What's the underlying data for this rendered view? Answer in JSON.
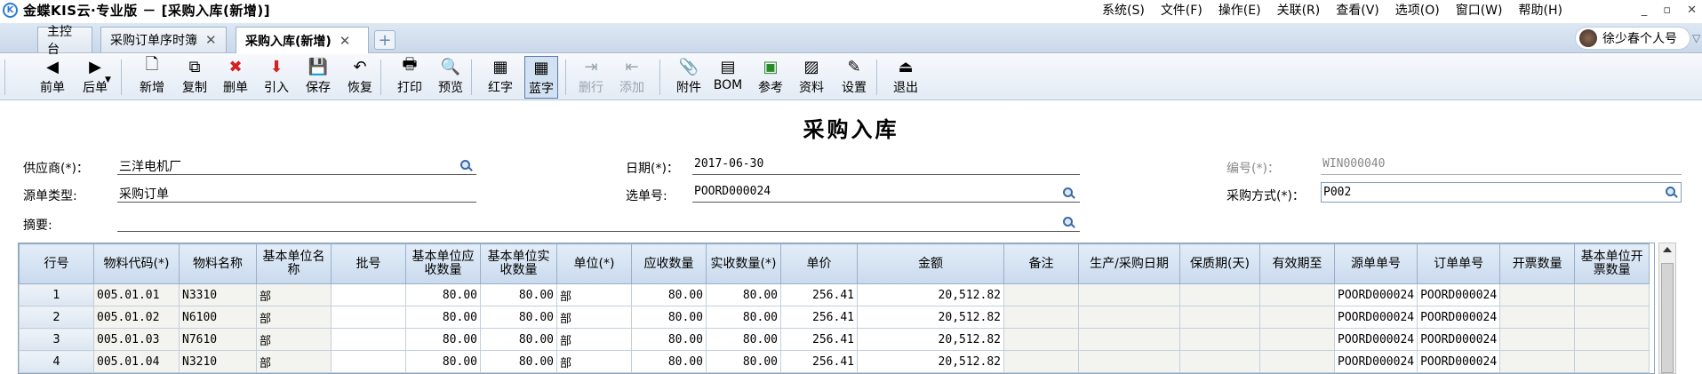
{
  "app": {
    "title": "金蝶KIS云·专业版 － [采购入库(新增)]",
    "menu": [
      "系统(S)",
      "文件(F)",
      "操作(E)",
      "关联(R)",
      "查看(V)",
      "选项(O)",
      "窗口(W)",
      "帮助(H)"
    ],
    "window_controls": [
      "_",
      "▫",
      "✕"
    ]
  },
  "tabs": [
    {
      "label": "主控台",
      "closable": false,
      "active": false
    },
    {
      "label": "采购订单序时簿",
      "closable": true,
      "active": false
    },
    {
      "label": "采购入库(新增)",
      "closable": true,
      "active": true
    }
  ],
  "tab_add_icon": "+",
  "user": {
    "name": "徐少春个人号"
  },
  "toolbar": [
    {
      "id": "prev",
      "label": "前单",
      "icon": "◀",
      "icon_name": "prev-arrow-icon"
    },
    {
      "id": "next",
      "label": "后单",
      "icon": "▶",
      "icon_name": "next-arrow-icon"
    },
    {
      "id": "new",
      "label": "新增",
      "icon": "🗋",
      "icon_name": "new-doc-icon"
    },
    {
      "id": "copy",
      "label": "复制",
      "icon": "⧉",
      "icon_name": "copy-icon"
    },
    {
      "id": "delete",
      "label": "删单",
      "icon": "✖",
      "icon_name": "delete-icon",
      "color": "#d32020"
    },
    {
      "id": "import",
      "label": "引入",
      "icon": "⬇",
      "icon_name": "import-icon",
      "color": "#d32020"
    },
    {
      "id": "save",
      "label": "保存",
      "icon": "💾",
      "icon_name": "save-icon"
    },
    {
      "id": "restore",
      "label": "恢复",
      "icon": "↶",
      "icon_name": "restore-icon"
    },
    {
      "id": "print",
      "label": "打印",
      "icon": "🖶",
      "icon_name": "print-icon"
    },
    {
      "id": "preview",
      "label": "预览",
      "icon": "🔍",
      "icon_name": "preview-icon"
    },
    {
      "id": "red",
      "label": "红字",
      "icon": "▦",
      "icon_name": "red-invoice-icon"
    },
    {
      "id": "blue",
      "label": "蓝字",
      "icon": "▦",
      "icon_name": "blue-invoice-icon",
      "pressed": true
    },
    {
      "id": "delrow",
      "label": "删行",
      "icon": "⇥",
      "icon_name": "delete-row-icon",
      "disabled": true
    },
    {
      "id": "addrow",
      "label": "添加",
      "icon": "⇤",
      "icon_name": "add-row-icon",
      "disabled": true
    },
    {
      "id": "attach",
      "label": "附件",
      "icon": "📎",
      "icon_name": "attachment-icon"
    },
    {
      "id": "bom",
      "label": "BOM",
      "icon": "▤",
      "icon_name": "bom-icon"
    },
    {
      "id": "ref",
      "label": "参考",
      "icon": "▣",
      "icon_name": "reference-icon",
      "color": "#2a8a2a"
    },
    {
      "id": "data",
      "label": "资料",
      "icon": "▨",
      "icon_name": "data-icon"
    },
    {
      "id": "settings",
      "label": "设置",
      "icon": "✎",
      "icon_name": "settings-icon"
    },
    {
      "id": "exit",
      "label": "退出",
      "icon": "⏏",
      "icon_name": "exit-icon"
    }
  ],
  "form": {
    "title": "采购入库",
    "supplier": {
      "label": "供应商(*)：",
      "value": "三洋电机厂"
    },
    "date": {
      "label": "日期(*)：",
      "value": "2017-06-30"
    },
    "number": {
      "label": "编号(*)：",
      "value": "WIN000040"
    },
    "source_type": {
      "label": "源单类型:",
      "value": "采购订单"
    },
    "source_no": {
      "label": "选单号:",
      "value": "POORD000024"
    },
    "purchase_method": {
      "label": "采购方式(*)：",
      "value": "P002"
    },
    "summary": {
      "label": "摘要:",
      "value": ""
    }
  },
  "grid": {
    "columns": [
      "行号",
      "物料代码(*)",
      "物料名称",
      "基本单位名称",
      "批号",
      "基本单位应收数量",
      "基本单位实收数量",
      "单位(*)",
      "应收数量",
      "实收数量(*)",
      "单价",
      "金额",
      "备注",
      "生产/采购日期",
      "保质期(天)",
      "有效期至",
      "源单单号",
      "订单单号",
      "开票数量",
      "基本单位开票数量"
    ],
    "rows": [
      [
        "1",
        "005.01.01",
        "N3310",
        "部",
        "",
        "80.00",
        "80.00",
        "部",
        "80.00",
        "80.00",
        "256.41",
        "20,512.82",
        "",
        "",
        "",
        "",
        "POORD000024",
        "POORD000024",
        "",
        ""
      ],
      [
        "2",
        "005.01.02",
        "N6100",
        "部",
        "",
        "80.00",
        "80.00",
        "部",
        "80.00",
        "80.00",
        "256.41",
        "20,512.82",
        "",
        "",
        "",
        "",
        "POORD000024",
        "POORD000024",
        "",
        ""
      ],
      [
        "3",
        "005.01.03",
        "N7610",
        "部",
        "",
        "80.00",
        "80.00",
        "部",
        "80.00",
        "80.00",
        "256.41",
        "20,512.82",
        "",
        "",
        "",
        "",
        "POORD000024",
        "POORD000024",
        "",
        ""
      ],
      [
        "4",
        "005.01.04",
        "N3210",
        "部",
        "",
        "80.00",
        "80.00",
        "部",
        "80.00",
        "80.00",
        "256.41",
        "20,512.82",
        "",
        "",
        "",
        "",
        "POORD000024",
        "POORD000024",
        "",
        ""
      ]
    ]
  }
}
